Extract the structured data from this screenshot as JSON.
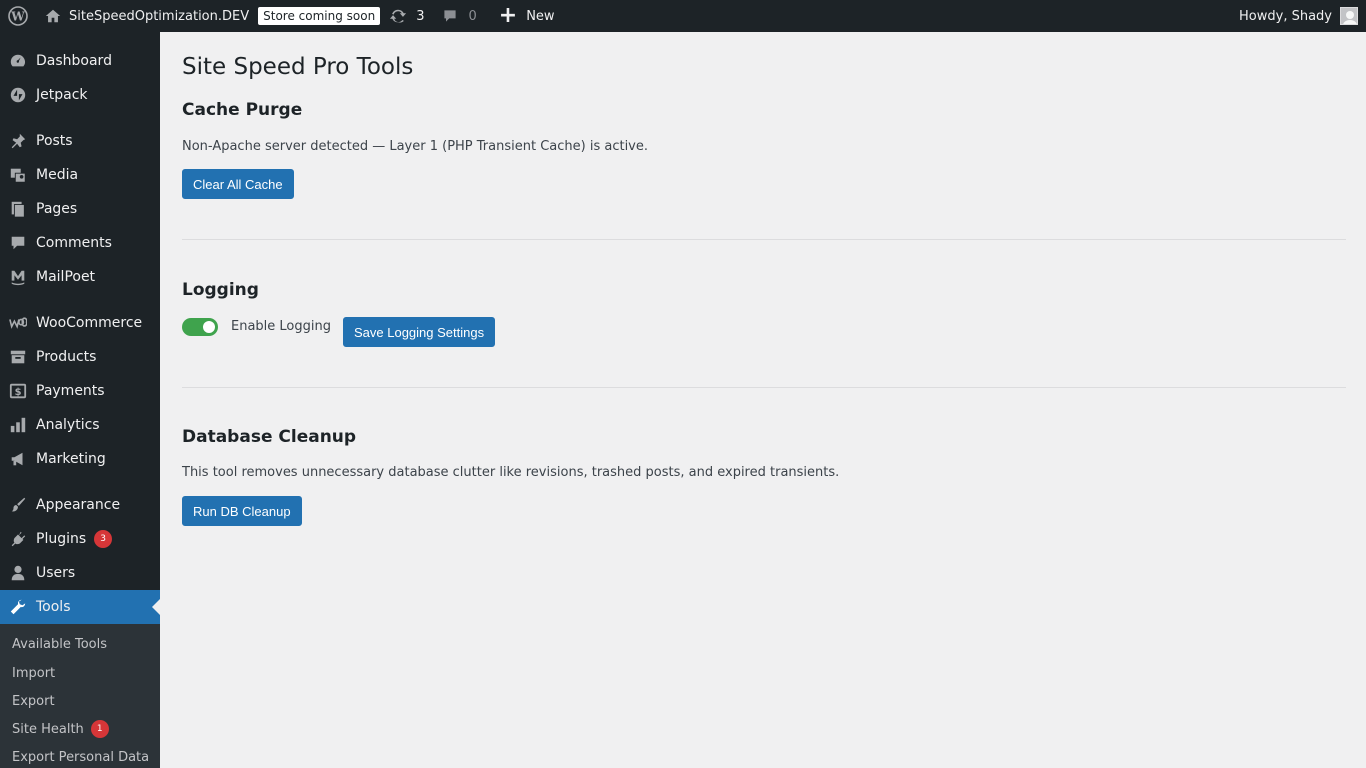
{
  "adminbar": {
    "site_name": "SiteSpeedOptimization.DEV",
    "store_badge": "Store coming soon",
    "updates_count": "3",
    "comments_count": "0",
    "new_label": "New",
    "howdy": "Howdy, Shady"
  },
  "sidebar": {
    "items": [
      {
        "label": "Dashboard",
        "icon": "dashboard-icon"
      },
      {
        "label": "Jetpack",
        "icon": "jetpack-icon"
      },
      {
        "label": "Posts",
        "icon": "pin-icon"
      },
      {
        "label": "Media",
        "icon": "media-icon"
      },
      {
        "label": "Pages",
        "icon": "pages-icon"
      },
      {
        "label": "Comments",
        "icon": "comment-icon"
      },
      {
        "label": "MailPoet",
        "icon": "mailpoet-icon"
      },
      {
        "label": "WooCommerce",
        "icon": "woocommerce-icon"
      },
      {
        "label": "Products",
        "icon": "archive-icon"
      },
      {
        "label": "Payments",
        "icon": "dollar-icon"
      },
      {
        "label": "Analytics",
        "icon": "bar-chart-icon"
      },
      {
        "label": "Marketing",
        "icon": "megaphone-icon"
      },
      {
        "label": "Appearance",
        "icon": "paintbrush-icon"
      },
      {
        "label": "Plugins",
        "icon": "plugin-icon",
        "badge": "3"
      },
      {
        "label": "Users",
        "icon": "user-icon"
      },
      {
        "label": "Tools",
        "icon": "wrench-icon",
        "active": true
      }
    ],
    "submenu": [
      {
        "label": "Available Tools"
      },
      {
        "label": "Import"
      },
      {
        "label": "Export"
      },
      {
        "label": "Site Health",
        "badge": "1"
      },
      {
        "label": "Export Personal Data"
      }
    ]
  },
  "main": {
    "page_title": "Site Speed Pro Tools",
    "cache": {
      "title": "Cache Purge",
      "description": "Non-Apache server detected — Layer 1 (PHP Transient Cache) is active.",
      "button": "Clear All Cache"
    },
    "logging": {
      "title": "Logging",
      "toggle_label": "Enable Logging",
      "toggle_on": true,
      "button": "Save Logging Settings"
    },
    "database": {
      "title": "Database Cleanup",
      "description": "This tool removes unnecessary database clutter like revisions, trashed posts, and expired transients.",
      "button": "Run DB Cleanup"
    }
  },
  "colors": {
    "adminbar_bg": "#1d2327",
    "accent": "#2271b1",
    "toggle_on": "#3fa34d",
    "badge": "#d63638",
    "content_bg": "#f0f0f1"
  }
}
